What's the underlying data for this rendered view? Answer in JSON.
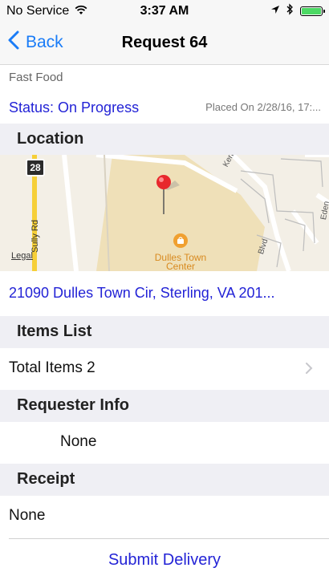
{
  "status_bar": {
    "carrier": "No Service",
    "time": "3:37 AM",
    "battery_color": "#4cd964"
  },
  "nav": {
    "back_label": "Back",
    "title": "Request 64"
  },
  "order": {
    "category": "Fast Food",
    "status": "Status: On Progress",
    "placed_on": "Placed On 2/28/16, 17:..."
  },
  "sections": {
    "location": "Location",
    "items_list": "Items List",
    "requester_info": "Requester Info",
    "receipt": "Receipt"
  },
  "map": {
    "route_shield": "28",
    "road_left": "Sully Rd",
    "road_kent": "Kent Champions",
    "road_blvd": "Blvd",
    "road_eden": "Eden",
    "poi": "Dulles Town Center",
    "legal": "Legal"
  },
  "location": {
    "address": "21090 Dulles Town Cir, Sterling, VA 201..."
  },
  "items": {
    "total": "Total Items 2"
  },
  "requester": {
    "value": "None"
  },
  "receipt": {
    "value": "None"
  },
  "actions": {
    "submit": "Submit Delivery"
  },
  "colors": {
    "accent_blue": "#1a7cf7",
    "link_blue": "#2323d6",
    "section_bg": "#efeff4"
  }
}
